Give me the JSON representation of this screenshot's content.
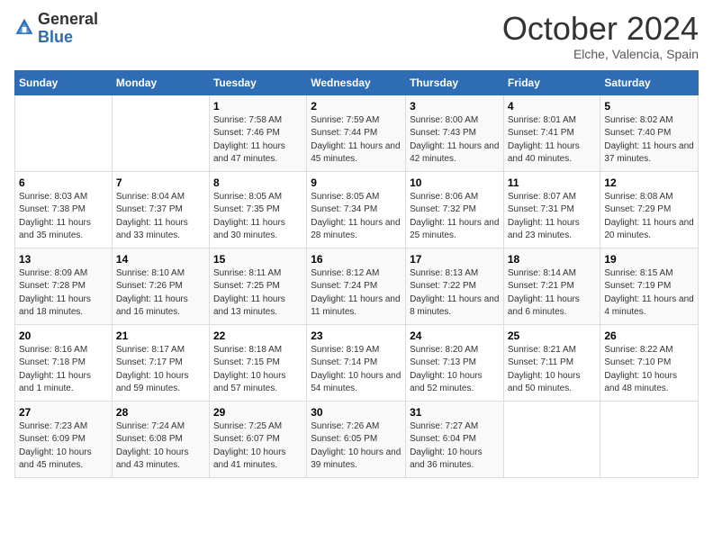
{
  "logo": {
    "text_general": "General",
    "text_blue": "Blue"
  },
  "title": {
    "month_year": "October 2024",
    "location": "Elche, Valencia, Spain"
  },
  "days_of_week": [
    "Sunday",
    "Monday",
    "Tuesday",
    "Wednesday",
    "Thursday",
    "Friday",
    "Saturday"
  ],
  "weeks": [
    [
      {
        "day": "",
        "info": ""
      },
      {
        "day": "",
        "info": ""
      },
      {
        "day": "1",
        "info": "Sunrise: 7:58 AM\nSunset: 7:46 PM\nDaylight: 11 hours and 47 minutes."
      },
      {
        "day": "2",
        "info": "Sunrise: 7:59 AM\nSunset: 7:44 PM\nDaylight: 11 hours and 45 minutes."
      },
      {
        "day": "3",
        "info": "Sunrise: 8:00 AM\nSunset: 7:43 PM\nDaylight: 11 hours and 42 minutes."
      },
      {
        "day": "4",
        "info": "Sunrise: 8:01 AM\nSunset: 7:41 PM\nDaylight: 11 hours and 40 minutes."
      },
      {
        "day": "5",
        "info": "Sunrise: 8:02 AM\nSunset: 7:40 PM\nDaylight: 11 hours and 37 minutes."
      }
    ],
    [
      {
        "day": "6",
        "info": "Sunrise: 8:03 AM\nSunset: 7:38 PM\nDaylight: 11 hours and 35 minutes."
      },
      {
        "day": "7",
        "info": "Sunrise: 8:04 AM\nSunset: 7:37 PM\nDaylight: 11 hours and 33 minutes."
      },
      {
        "day": "8",
        "info": "Sunrise: 8:05 AM\nSunset: 7:35 PM\nDaylight: 11 hours and 30 minutes."
      },
      {
        "day": "9",
        "info": "Sunrise: 8:05 AM\nSunset: 7:34 PM\nDaylight: 11 hours and 28 minutes."
      },
      {
        "day": "10",
        "info": "Sunrise: 8:06 AM\nSunset: 7:32 PM\nDaylight: 11 hours and 25 minutes."
      },
      {
        "day": "11",
        "info": "Sunrise: 8:07 AM\nSunset: 7:31 PM\nDaylight: 11 hours and 23 minutes."
      },
      {
        "day": "12",
        "info": "Sunrise: 8:08 AM\nSunset: 7:29 PM\nDaylight: 11 hours and 20 minutes."
      }
    ],
    [
      {
        "day": "13",
        "info": "Sunrise: 8:09 AM\nSunset: 7:28 PM\nDaylight: 11 hours and 18 minutes."
      },
      {
        "day": "14",
        "info": "Sunrise: 8:10 AM\nSunset: 7:26 PM\nDaylight: 11 hours and 16 minutes."
      },
      {
        "day": "15",
        "info": "Sunrise: 8:11 AM\nSunset: 7:25 PM\nDaylight: 11 hours and 13 minutes."
      },
      {
        "day": "16",
        "info": "Sunrise: 8:12 AM\nSunset: 7:24 PM\nDaylight: 11 hours and 11 minutes."
      },
      {
        "day": "17",
        "info": "Sunrise: 8:13 AM\nSunset: 7:22 PM\nDaylight: 11 hours and 8 minutes."
      },
      {
        "day": "18",
        "info": "Sunrise: 8:14 AM\nSunset: 7:21 PM\nDaylight: 11 hours and 6 minutes."
      },
      {
        "day": "19",
        "info": "Sunrise: 8:15 AM\nSunset: 7:19 PM\nDaylight: 11 hours and 4 minutes."
      }
    ],
    [
      {
        "day": "20",
        "info": "Sunrise: 8:16 AM\nSunset: 7:18 PM\nDaylight: 11 hours and 1 minute."
      },
      {
        "day": "21",
        "info": "Sunrise: 8:17 AM\nSunset: 7:17 PM\nDaylight: 10 hours and 59 minutes."
      },
      {
        "day": "22",
        "info": "Sunrise: 8:18 AM\nSunset: 7:15 PM\nDaylight: 10 hours and 57 minutes."
      },
      {
        "day": "23",
        "info": "Sunrise: 8:19 AM\nSunset: 7:14 PM\nDaylight: 10 hours and 54 minutes."
      },
      {
        "day": "24",
        "info": "Sunrise: 8:20 AM\nSunset: 7:13 PM\nDaylight: 10 hours and 52 minutes."
      },
      {
        "day": "25",
        "info": "Sunrise: 8:21 AM\nSunset: 7:11 PM\nDaylight: 10 hours and 50 minutes."
      },
      {
        "day": "26",
        "info": "Sunrise: 8:22 AM\nSunset: 7:10 PM\nDaylight: 10 hours and 48 minutes."
      }
    ],
    [
      {
        "day": "27",
        "info": "Sunrise: 7:23 AM\nSunset: 6:09 PM\nDaylight: 10 hours and 45 minutes."
      },
      {
        "day": "28",
        "info": "Sunrise: 7:24 AM\nSunset: 6:08 PM\nDaylight: 10 hours and 43 minutes."
      },
      {
        "day": "29",
        "info": "Sunrise: 7:25 AM\nSunset: 6:07 PM\nDaylight: 10 hours and 41 minutes."
      },
      {
        "day": "30",
        "info": "Sunrise: 7:26 AM\nSunset: 6:05 PM\nDaylight: 10 hours and 39 minutes."
      },
      {
        "day": "31",
        "info": "Sunrise: 7:27 AM\nSunset: 6:04 PM\nDaylight: 10 hours and 36 minutes."
      },
      {
        "day": "",
        "info": ""
      },
      {
        "day": "",
        "info": ""
      }
    ]
  ]
}
